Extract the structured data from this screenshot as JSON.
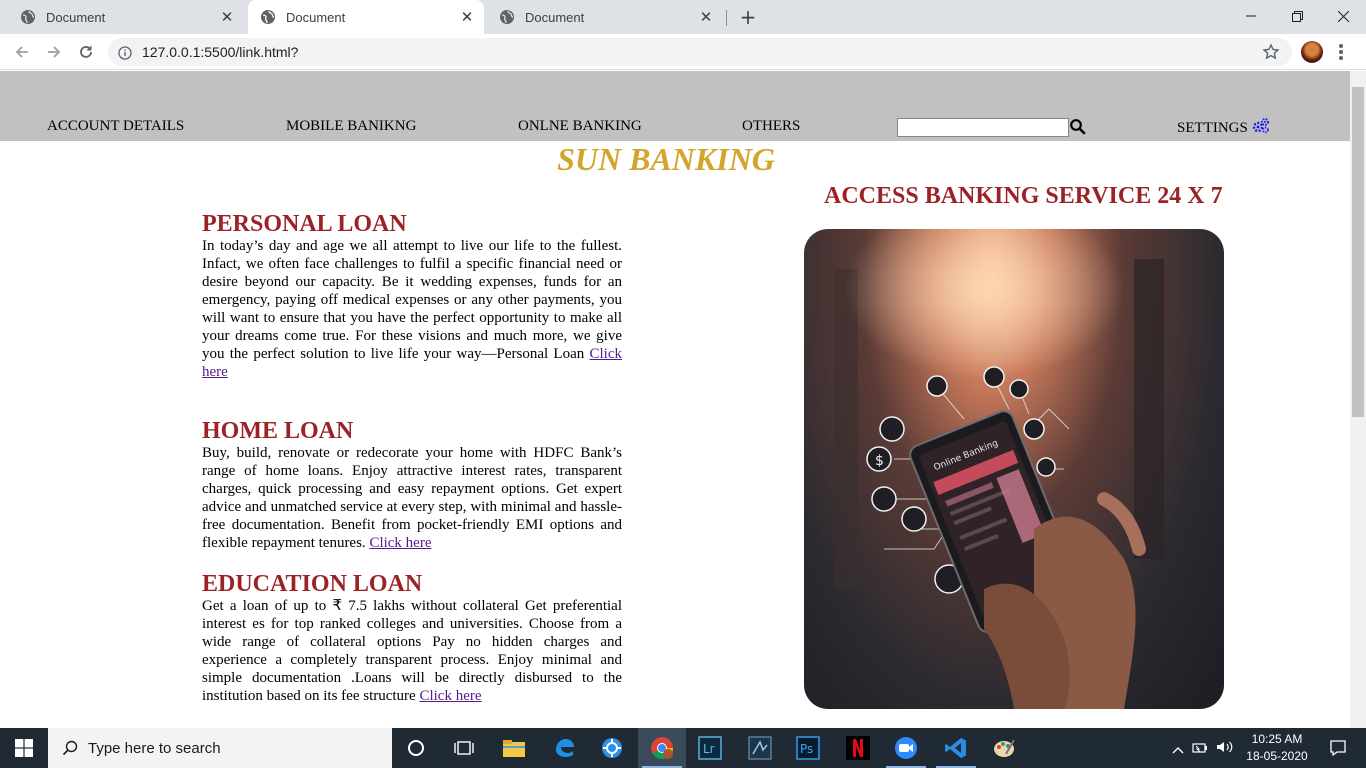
{
  "browser": {
    "tabs": [
      {
        "title": "Document",
        "active": false
      },
      {
        "title": "Document",
        "active": true
      },
      {
        "title": "Document",
        "active": false
      }
    ],
    "url": "127.0.0.1:5500/link.html?"
  },
  "page": {
    "nav": {
      "items": [
        "ACCOUNT DETAILS",
        "MOBILE BANIKNG",
        "ONLNE BANKING",
        "OTHERS"
      ],
      "search_value": "",
      "settings_label": "SETTINGS"
    },
    "brand": "SUN BANKING",
    "access_title": "ACCESS BANKING SERVICE 24 X 7",
    "loans": [
      {
        "title": "PERSONAL LOAN",
        "body": "In today’s day and age we all attempt to live our life to the fullest. Infact, we often face challenges to fulfil a specific financial need or desire beyond our capacity. Be it wedding expenses, funds for an emergency, paying off medical expenses or any other payments, you will want to ensure that you have the perfect opportunity to make all your dreams come true. For these visions and much more, we give you the perfect solution to live life your way—Personal Loan",
        "link": "Click here"
      },
      {
        "title": "HOME LOAN",
        "body": "Buy, build, renovate or redecorate your home with HDFC Bank’s range of home loans. Enjoy attractive interest rates, transparent charges, quick processing and easy repayment options. Get expert advice and unmatched service at every step, with minimal and hassle-free documentation. Benefit from pocket-friendly EMI options and flexible repayment tenures.",
        "link": "Click here"
      },
      {
        "title": "EDUCATION LOAN",
        "body": "Get a loan of up to ₹ 7.5 lakhs without collateral Get preferential interest es for top ranked colleges and universities. Choose from a wide range of collateral options Pay no hidden charges and experience a completely transparent process. Enjoy minimal and simple documentation .Loans will be directly disbursed to the institution based on its fee structure",
        "link": "Click here"
      }
    ],
    "hero_screen_label": "Online Banking"
  },
  "taskbar": {
    "search_placeholder": "Type here to search",
    "apps": [
      "task-view",
      "file-explorer",
      "edge",
      "app",
      "chrome",
      "lightroom",
      "app",
      "photoshop",
      "netflix",
      "zoom",
      "vscode",
      "paint"
    ],
    "time": "10:25 AM",
    "date": "18-05-2020"
  },
  "colors": {
    "nav_bg": "#c1c1c1",
    "brand": "#d4a52c",
    "heading": "#9b2226",
    "link": "#551a8b"
  }
}
